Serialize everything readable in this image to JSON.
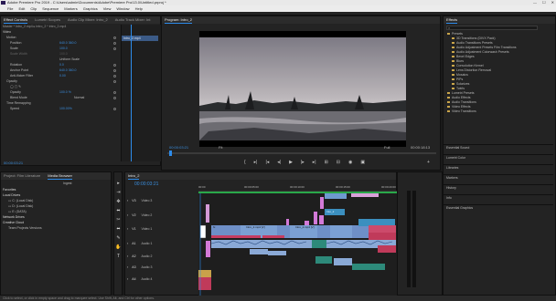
{
  "app": {
    "title": "Adobe Premiere Pro 2019 - C:\\Users\\admin\\Documents\\Adobe\\Premiere Pro\\13.0\\Untitled.prproj *",
    "window_controls": [
      "—",
      "☐",
      "✕"
    ]
  },
  "menu": [
    "File",
    "Edit",
    "Clip",
    "Sequence",
    "Markers",
    "Graphics",
    "View",
    "Window",
    "Help"
  ],
  "left_panel": {
    "tabs": [
      "Effect Controls",
      "Lumetri Scopes",
      "Audio Clip Mixer: Intro_2",
      "Audio Track Mixer: Int"
    ],
    "master_label": "Master * Intro_2.mp4 ▸ Intro_2 * Intro_2.mp4",
    "video_label": "Video",
    "rows": [
      {
        "label": "Motion",
        "value": ""
      },
      {
        "label": "Position",
        "value": "640.0   360.0"
      },
      {
        "label": "Scale",
        "value": "100.0"
      },
      {
        "label": "Scale Width",
        "value": "100.0"
      },
      {
        "label": "",
        "value": "Uniform Scale"
      },
      {
        "label": "Rotation",
        "value": "0.0"
      },
      {
        "label": "Anchor Point",
        "value": "640.0   360.0"
      },
      {
        "label": "Anti-flicker Filter",
        "value": "0.00"
      },
      {
        "label": "Opacity",
        "value": ""
      },
      {
        "label": "",
        "value": "◯ ▢ ✎"
      },
      {
        "label": "Opacity",
        "value": "100.0 %"
      },
      {
        "label": "Blend Mode",
        "value": "Normal"
      },
      {
        "label": "Time Remapping",
        "value": ""
      },
      {
        "label": "Speed",
        "value": "100.00%"
      }
    ],
    "bin_item": "Intro_2.mp4",
    "timecode": "00:00:03:21"
  },
  "program_monitor": {
    "tabs": [
      "Program: Intro_2"
    ],
    "timecode_left": "00:00:03:21",
    "fit_label": "Fit",
    "fraction_label": "Full",
    "timecode_right": "00:00:18:13",
    "transport": [
      "{",
      "▸|",
      "|◂",
      "◂|",
      "▶",
      "|▸",
      "▸|",
      "⊞",
      "⊟",
      "◉",
      "▣",
      "+"
    ]
  },
  "effects_panel": {
    "title": "Effects",
    "search_placeholder": "",
    "items": [
      {
        "label": "Presets",
        "indent": 0,
        "folder": true
      },
      {
        "label": "3D Transitions (DIVX Pack)",
        "indent": 1,
        "folder": true
      },
      {
        "label": "Audio Transitions Presets",
        "indent": 1,
        "folder": true
      },
      {
        "label": "Audio Adjustment Presets Film Transitions",
        "indent": 1,
        "folder": true
      },
      {
        "label": "Audio Adjustment Colorwash Presets",
        "indent": 1,
        "folder": true
      },
      {
        "label": "Bevel Edges",
        "indent": 1,
        "folder": true
      },
      {
        "label": "Blurs",
        "indent": 1,
        "folder": true
      },
      {
        "label": "Convolution Kernel",
        "indent": 1,
        "folder": true
      },
      {
        "label": "Lens Distortion Removal",
        "indent": 1,
        "folder": true
      },
      {
        "label": "Mosaics",
        "indent": 1,
        "folder": true
      },
      {
        "label": "PiPs",
        "indent": 1,
        "folder": true
      },
      {
        "label": "Solarizes",
        "indent": 1,
        "folder": true
      },
      {
        "label": "Twirls",
        "indent": 1,
        "folder": true
      },
      {
        "label": "Lumetri Presets",
        "indent": 0,
        "folder": true
      },
      {
        "label": "Audio Effects",
        "indent": 0,
        "folder": true
      },
      {
        "label": "Audio Transitions",
        "indent": 0,
        "folder": true
      },
      {
        "label": "Video Effects",
        "indent": 0,
        "folder": true
      },
      {
        "label": "Video Transitions",
        "indent": 0,
        "folder": true
      }
    ],
    "sections": [
      "Essential Sound",
      "Lumetri Color",
      "Libraries",
      "Markers",
      "History",
      "Info",
      "Essential Graphics"
    ]
  },
  "project_panel": {
    "tabs": [
      "Project: Film Literature",
      "Media Browser"
    ],
    "ingest_label": "Ingest",
    "section_favorites": "Favorites",
    "section_local": "Local Drives",
    "drives": [
      "C: (Local Disk)",
      "D: (Local Disk)",
      "E: (DATA)"
    ],
    "section_network": "Network Drives",
    "section_cloud": "Creative Cloud",
    "cloud_item": "Team Projects Versions"
  },
  "timeline": {
    "tab": "Intro_2",
    "timecode": "00:00:03:21",
    "ruler": [
      "00:00",
      "00:00:05:00",
      "00:00:10:00",
      "00:00:15:00",
      "00:00:20:00"
    ],
    "tracks": [
      "V3",
      "V2",
      "V1",
      "A1",
      "A2",
      "A3",
      "A4"
    ],
    "track_names": [
      "Video 3",
      "Video 2",
      "Video 1",
      "Audio 1",
      "Audio 2",
      "Audio 3",
      "Audio 4"
    ],
    "clip_labels": [
      "Intro_2.mp4 [V]",
      "Intro_2.mp4 [V]",
      "Into_2",
      "fx"
    ]
  },
  "tools": [
    "▸",
    "⇥",
    "✥",
    "⬌",
    "✂",
    "⬌",
    "✎",
    "✋",
    "T"
  ],
  "status": "Click to select, or click in empty space and drag to marquee select. Use Shift, Alt, and Ctrl for other options."
}
